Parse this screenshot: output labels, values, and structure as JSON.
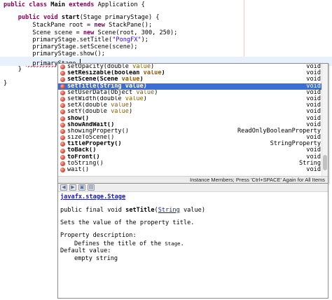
{
  "editor": {
    "lines": [
      {
        "t1": "public class ",
        "cls": "Main",
        "t2": " extends ",
        "t3": "Application {"
      },
      {
        "m1": "    public void ",
        "mname": "start",
        "m2": "(Stage primaryStage) {"
      },
      {
        "text": "        StackPane root = ",
        "kwnew": "new",
        "rest": " StackPane();"
      },
      {
        "text": "        Scene scene = ",
        "kwnew": "new",
        "rest": " Scene(root, 300, 250);"
      },
      {
        "pre": "        primaryStage.setTitle(",
        "str": "\"PongFX\"",
        "post": ");"
      },
      {
        "text": "        primaryStage.setScene(scene);"
      },
      {
        "text": "        primaryStage.show();"
      },
      {
        "text": "        primaryStage."
      },
      {
        "text": "    }"
      },
      {
        "text": "}"
      }
    ],
    "kw_public": "public",
    "kw_class": "class",
    "kw_void": "void",
    "kw_extends": "extends"
  },
  "completion": {
    "items": [
      {
        "pre": "setOpacity(double ",
        "param": "value",
        "post": ")",
        "ret": "void",
        "bold": false,
        "selected": false
      },
      {
        "pre": "setResizable(boolean ",
        "param": "value",
        "post": ")",
        "ret": "void",
        "bold": true,
        "selected": false
      },
      {
        "pre": "setScene(Scene ",
        "param": "value",
        "post": ")",
        "ret": "void",
        "bold": true,
        "selected": false
      },
      {
        "pre": "setTitle(String ",
        "param": "value",
        "post": ")",
        "ret": "void",
        "bold": true,
        "selected": true
      },
      {
        "pre": "setUserData(Object ",
        "param": "value",
        "post": ")",
        "ret": "void",
        "bold": false,
        "selected": false
      },
      {
        "pre": "setWidth(double ",
        "param": "value",
        "post": ")",
        "ret": "void",
        "bold": false,
        "selected": false
      },
      {
        "pre": "setX(double ",
        "param": "value",
        "post": ")",
        "ret": "void",
        "bold": false,
        "selected": false
      },
      {
        "pre": "setY(double ",
        "param": "value",
        "post": ")",
        "ret": "void",
        "bold": false,
        "selected": false
      },
      {
        "pre": "show()",
        "param": "",
        "post": "",
        "ret": "void",
        "bold": true,
        "selected": false
      },
      {
        "pre": "showAndWait()",
        "param": "",
        "post": "",
        "ret": "void",
        "bold": true,
        "selected": false
      },
      {
        "pre": "showingProperty()",
        "param": "",
        "post": "",
        "ret": "ReadOnlyBooleanProperty",
        "bold": false,
        "selected": false
      },
      {
        "pre": "sizeToScene()",
        "param": "",
        "post": "",
        "ret": "void",
        "bold": false,
        "selected": false
      },
      {
        "pre": "titleProperty()",
        "param": "",
        "post": "",
        "ret": "StringProperty",
        "bold": true,
        "selected": false
      },
      {
        "pre": "toBack()",
        "param": "",
        "post": "",
        "ret": "void",
        "bold": true,
        "selected": false
      },
      {
        "pre": "toFront()",
        "param": "",
        "post": "",
        "ret": "void",
        "bold": true,
        "selected": false
      },
      {
        "pre": "toString()",
        "param": "",
        "post": "",
        "ret": "String",
        "bold": false,
        "selected": false
      },
      {
        "pre": "wait()",
        "param": "",
        "post": "",
        "ret": "void",
        "bold": false,
        "selected": false
      }
    ],
    "status": "Instance Members; Press 'Ctrl+SPACE' Again for All Items"
  },
  "doc": {
    "toolbar": {
      "back": "◀",
      "forward": "▶",
      "web": "▣",
      "close": "▤"
    },
    "class_link": "javafx.stage.Stage",
    "signature_pre": "public final void ",
    "signature_name": "setTitle",
    "signature_open": "(",
    "signature_type": "String",
    "signature_post": " value)",
    "description": "Sets the value of the property title.",
    "prop_label": "Property description:",
    "prop_text_pre": "Defines the title of the ",
    "prop_text_code": "Stage",
    "prop_text_post": ".",
    "default_label": "Default value:",
    "default_value": "empty string"
  },
  "colors": {
    "keyword": "#7f0055",
    "string": "#2a00ff",
    "selection": "#3a6fd7",
    "link": "#1a1aa6"
  }
}
